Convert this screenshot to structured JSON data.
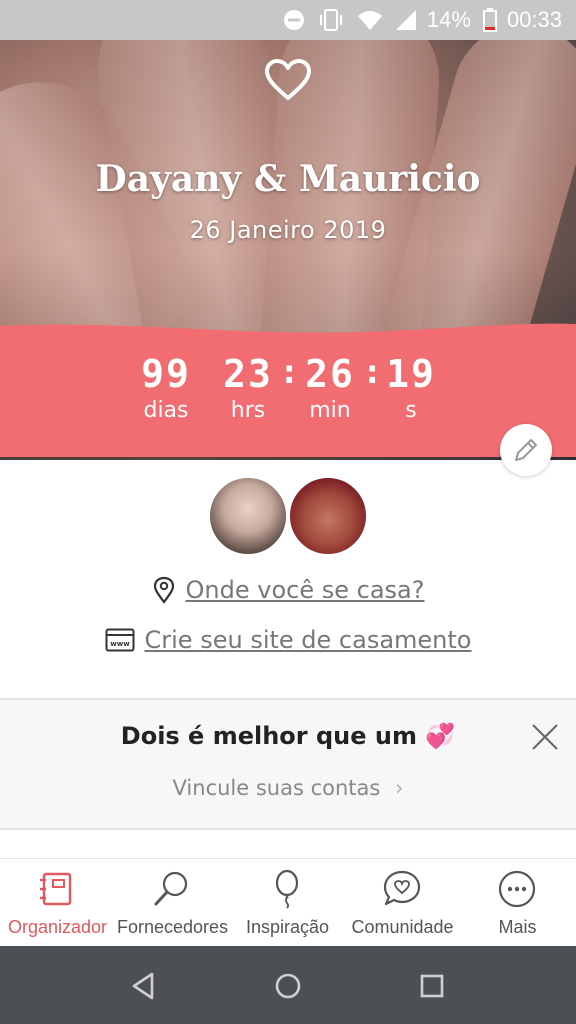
{
  "status_bar": {
    "battery": "14%",
    "time": "00:33",
    "icons": [
      "do-not-disturb-icon",
      "vibrate-icon",
      "wifi-icon",
      "cell-signal-icon",
      "battery-low-icon"
    ]
  },
  "hero": {
    "icon": "heart-icon",
    "names": "Dayany & Mauricio",
    "date": "26 Janeiro 2019"
  },
  "countdown": {
    "days": "99",
    "days_label": "dias",
    "hours": "23",
    "hours_label": "hrs",
    "minutes": "26",
    "minutes_label": "min",
    "seconds": "19",
    "seconds_label": "s",
    "separator": ":"
  },
  "links": {
    "venue": "Onde você se casa?",
    "website": "Crie seu site de casamento"
  },
  "promo": {
    "title": "Dois é melhor que um 💞",
    "subtitle": "Vincule suas contas"
  },
  "bottom_nav": {
    "items": [
      {
        "label": "Organizador",
        "icon": "planner-icon",
        "active": true
      },
      {
        "label": "Fornecedores",
        "icon": "search-icon",
        "active": false
      },
      {
        "label": "Inspiração",
        "icon": "balloon-icon",
        "active": false
      },
      {
        "label": "Comunidade",
        "icon": "chat-heart-icon",
        "active": false
      },
      {
        "label": "Mais",
        "icon": "more-icon",
        "active": false
      }
    ]
  },
  "colors": {
    "accent": "#f26d72",
    "active_nav": "#e1585d",
    "status_bar": "#c7c7c7",
    "system_nav": "#4c4f53"
  }
}
